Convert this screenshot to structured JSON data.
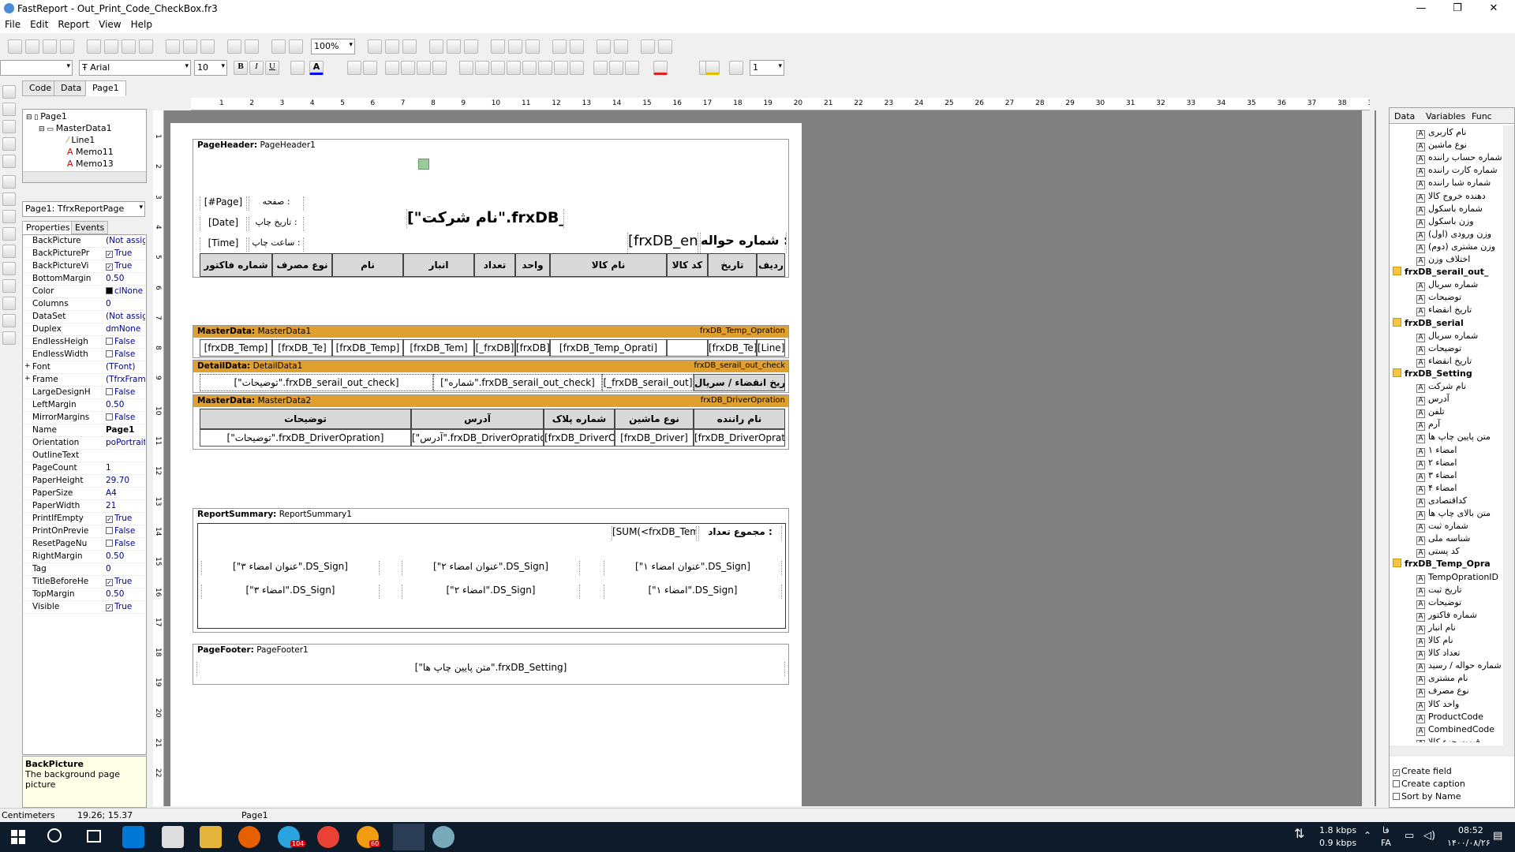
{
  "title": "FastReport - Out_Print_Code_CheckBox.fr3",
  "menu": [
    "File",
    "Edit",
    "Report",
    "View",
    "Help"
  ],
  "toolbar": {
    "zoom": "100%",
    "font": "Arial",
    "size": "10",
    "bold": "B",
    "italic": "I",
    "underline": "U",
    "fontcolor": "A",
    "linewidth": "1"
  },
  "tabs": [
    "Code",
    "Data",
    "Page1"
  ],
  "tree": {
    "items": [
      "Page1",
      "MasterData1",
      "Line1",
      "Memo11",
      "Memo13"
    ]
  },
  "objcombo": "Page1: TfrxReportPage",
  "proptabs": [
    "Properties",
    "Events"
  ],
  "props": [
    {
      "k": "BackPicture",
      "v": "(Not assigned)"
    },
    {
      "k": "BackPicturePr",
      "v": "True",
      "cb": "✓"
    },
    {
      "k": "BackPictureVi",
      "v": "True",
      "cb": "✓"
    },
    {
      "k": "BottomMargin",
      "v": "0.50"
    },
    {
      "k": "Color",
      "v": "clNone"
    },
    {
      "k": "Columns",
      "v": "0"
    },
    {
      "k": "DataSet",
      "v": "(Not assigned)"
    },
    {
      "k": "Duplex",
      "v": "dmNone"
    },
    {
      "k": "EndlessHeigh",
      "v": "False",
      "cb": " "
    },
    {
      "k": "EndlessWidth",
      "v": "False",
      "cb": " "
    },
    {
      "k": "Font",
      "v": "(TFont)",
      "pre": "+"
    },
    {
      "k": "Frame",
      "v": "(TfrxFrame)",
      "pre": "+"
    },
    {
      "k": "LargeDesignH",
      "v": "False",
      "cb": " "
    },
    {
      "k": "LeftMargin",
      "v": "0.50"
    },
    {
      "k": "MirrorMargins",
      "v": "False",
      "cb": " "
    },
    {
      "k": "Name",
      "v": "Page1",
      "bold": true
    },
    {
      "k": "Orientation",
      "v": "poPortrait"
    },
    {
      "k": "OutlineText",
      "v": ""
    },
    {
      "k": "PageCount",
      "v": "1"
    },
    {
      "k": "PaperHeight",
      "v": "29.70"
    },
    {
      "k": "PaperSize",
      "v": "A4"
    },
    {
      "k": "PaperWidth",
      "v": "21"
    },
    {
      "k": "PrintIfEmpty",
      "v": "True",
      "cb": "✓"
    },
    {
      "k": "PrintOnPrevie",
      "v": "False",
      "cb": " "
    },
    {
      "k": "ResetPageNu",
      "v": "False",
      "cb": " "
    },
    {
      "k": "RightMargin",
      "v": "0.50"
    },
    {
      "k": "Tag",
      "v": "0"
    },
    {
      "k": "TitleBeforeHe",
      "v": "True",
      "cb": "✓"
    },
    {
      "k": "TopMargin",
      "v": "0.50"
    },
    {
      "k": "Visible",
      "v": "True",
      "cb": "✓"
    }
  ],
  "hint": {
    "title": "BackPicture",
    "text": "The background page picture"
  },
  "hruler": [
    "1",
    "2",
    "3",
    "4",
    "5",
    "6",
    "7",
    "8",
    "9",
    "10",
    "11",
    "12",
    "13",
    "14",
    "15",
    "16",
    "17",
    "18",
    "19",
    "20",
    "21",
    "22",
    "23",
    "24",
    "25",
    "26",
    "27",
    "28",
    "29",
    "30",
    "31",
    "32",
    "33",
    "34",
    "35",
    "36",
    "37",
    "38",
    "39"
  ],
  "vruler": [
    "1",
    "2",
    "3",
    "4",
    "5",
    "6",
    "7",
    "8",
    "9",
    "10",
    "11",
    "12",
    "13",
    "14",
    "15",
    "16",
    "17",
    "18",
    "19",
    "20",
    "21",
    "22"
  ],
  "pageheader": {
    "label": "PageHeader:",
    "name": "PageHeader1",
    "page": "[#Page]",
    "date": "[Date]",
    "time": "[Time]",
    "page_lbl": "صفحه :",
    "date_lbl": "تاریخ چاپ :",
    "time_lbl": "ساعت چاپ :",
    "company": "[\"نام شرکت\".frxDB_Setting]",
    "transfer_lbl": "شماره حواله :",
    "transfer": "[frxDB_ent]",
    "headers": [
      "ردیف",
      "تاریخ",
      "کد کالا",
      "نام کالا",
      "واحد",
      "تعداد",
      "انبار",
      "نام",
      "نوع مصرف",
      "شماره فاکتور"
    ]
  },
  "master1": {
    "label": "MasterData:",
    "name": "MasterData1",
    "ds": "frxDB_Temp_Opration",
    "cells": [
      "[Line]",
      "[frxDB_Te]",
      "",
      "[frxDB_Temp_Oprati]",
      "[frxDB]",
      "[_frxDB]",
      "[frxDB_Tem]",
      "[frxDB_Temp]",
      "[frxDB_Te]",
      "[frxDB_Temp]"
    ]
  },
  "detail1": {
    "label": "DetailData:",
    "name": "DetailData1",
    "ds": "frxDB_serail_out_check",
    "cells": [
      "تاریخ انقضاء / سریال",
      "[_frxDB_serail_out]",
      "[\"شماره\".frxDB_serail_out_check]",
      "[\"توضیحات\".frxDB_serail_out_check]"
    ]
  },
  "master2": {
    "label": "MasterData:",
    "name": "MasterData2",
    "ds": "frxDB_DriverOpration",
    "headers": [
      "نام راننده",
      "نوع ماشین",
      "شماره پلاک",
      "آدرس",
      "توضیحات"
    ],
    "cells": [
      "[frxDB_DriverOpratio]",
      "[frxDB_Driver]",
      "[frxDB_DriverOp]",
      "[\"آدرس\".frxDB_DriverOpration]",
      "[\"توضیحات\".frxDB_DriverOpration]"
    ]
  },
  "summary": {
    "label": "ReportSummary:",
    "name": "ReportSummary1",
    "total_lbl": "مجموع تعداد :",
    "total": "[SUM(<frxDB_Tem]",
    "s1": "[\"عنوان امضاء ۱\".DS_Sign]",
    "s2": "[\"عنوان امضاء ۲\".DS_Sign]",
    "s3": "[\"عنوان امضاء ۳\".DS_Sign]",
    "a1": "[\"امضاء ۱\".DS_Sign]",
    "a2": "[\"امضاء ۲\".DS_Sign]",
    "a3": "[\"امضاء ۳\".DS_Sign]"
  },
  "footer": {
    "label": "PageFooter:",
    "name": "PageFooter1",
    "text": "[\"متن پایین چاپ ها\".frxDB_Setting]"
  },
  "datatabs": [
    "Data",
    "Variables",
    "Func"
  ],
  "datatree": [
    {
      "t": "f",
      "v": "نام کاربری"
    },
    {
      "t": "f",
      "v": "نوع ماشین"
    },
    {
      "t": "f",
      "v": "شماره حساب راننده"
    },
    {
      "t": "f",
      "v": "شماره کارت راننده"
    },
    {
      "t": "f",
      "v": "شماره شبا راننده"
    },
    {
      "t": "f",
      "v": "دهنده خروج کالا"
    },
    {
      "t": "f",
      "v": "شماره باسکول"
    },
    {
      "t": "f",
      "v": "وزن باسکول"
    },
    {
      "t": "f",
      "v": "وزن ورودی (اول)"
    },
    {
      "t": "f",
      "v": "وزن مشتری (دوم)"
    },
    {
      "t": "f",
      "v": "اختلاف وزن"
    },
    {
      "t": "h",
      "v": "frxDB_serail_out_"
    },
    {
      "t": "f",
      "v": "شماره سریال"
    },
    {
      "t": "f",
      "v": "توضیحات"
    },
    {
      "t": "f",
      "v": "تاریخ انقضاء"
    },
    {
      "t": "h",
      "v": "frxDB_serial"
    },
    {
      "t": "f",
      "v": "شماره سریال"
    },
    {
      "t": "f",
      "v": "توضیحات"
    },
    {
      "t": "f",
      "v": "تاریخ انقضاء"
    },
    {
      "t": "h",
      "v": "frxDB_Setting"
    },
    {
      "t": "f",
      "v": "نام شرکت"
    },
    {
      "t": "f",
      "v": "آدرس"
    },
    {
      "t": "f",
      "v": "تلفن"
    },
    {
      "t": "f",
      "v": "آرم"
    },
    {
      "t": "f",
      "v": "متن پایین چاپ ها"
    },
    {
      "t": "f",
      "v": "امضاء ۱"
    },
    {
      "t": "f",
      "v": "امضاء ۲"
    },
    {
      "t": "f",
      "v": "امضاء ۳"
    },
    {
      "t": "f",
      "v": "امضاء ۴"
    },
    {
      "t": "f",
      "v": "کداقتصادی"
    },
    {
      "t": "f",
      "v": "متن بالای چاپ ها"
    },
    {
      "t": "f",
      "v": "شماره ثبت"
    },
    {
      "t": "f",
      "v": "شناسه ملی"
    },
    {
      "t": "f",
      "v": "کد پستی"
    },
    {
      "t": "h",
      "v": "frxDB_Temp_Opra"
    },
    {
      "t": "f",
      "v": "TempOprationID"
    },
    {
      "t": "f",
      "v": "تاریخ ثبت"
    },
    {
      "t": "f",
      "v": "توضیحات"
    },
    {
      "t": "f",
      "v": "شماره فاکتور"
    },
    {
      "t": "f",
      "v": "نام انبار"
    },
    {
      "t": "f",
      "v": "نام کالا"
    },
    {
      "t": "f",
      "v": "تعداد کالا"
    },
    {
      "t": "f",
      "v": "شماره حواله / رسید"
    },
    {
      "t": "f",
      "v": "نام مشتری"
    },
    {
      "t": "f",
      "v": "نوع مصرف"
    },
    {
      "t": "f",
      "v": "واحد کالا"
    },
    {
      "t": "f",
      "v": "ProductCode"
    },
    {
      "t": "f",
      "v": "CombinedCode"
    },
    {
      "t": "f",
      "v": "قیمت جزء کالا"
    }
  ],
  "dataopts": [
    {
      "label": "Create field",
      "checked": true
    },
    {
      "label": "Create caption",
      "checked": false
    },
    {
      "label": "Sort by Name",
      "checked": false
    }
  ],
  "status": {
    "units": "Centimeters",
    "coords": "19.26; 15.37",
    "page": "Page1"
  },
  "tray": {
    "up": "1.8 kbps",
    "down": "0.9 kbps",
    "lang": "FA",
    "lang2": "فا",
    "time": "08:52",
    "date": "۱۴۰۰/۰۸/۲۶",
    "badge1": "104",
    "badge2": "60"
  },
  "colors": {
    "band_header": "#e0a030",
    "canvas": "#808080",
    "taskbar": "#0d1b2a"
  }
}
